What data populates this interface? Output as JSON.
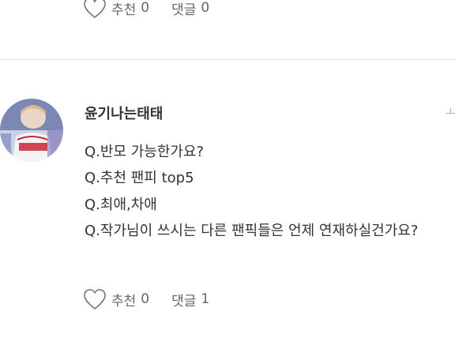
{
  "top_actions": {
    "recommend_label": "추천",
    "recommend_count": "0",
    "comment_label": "댓글",
    "comment_count": "0"
  },
  "comment": {
    "author": "윤기나는태태",
    "edge_glyph": "ㅗ",
    "lines": [
      "Q.반모 가능한가요?",
      "Q.추천 팬피 top5",
      "Q.최애,차애",
      "Q.작가님이 쓰시는 다른 팬픽들은 언제 연재하실건가요?"
    ]
  },
  "bottom_actions": {
    "recommend_label": "추천",
    "recommend_count": "0",
    "comment_label": "댓글",
    "comment_count": "1"
  }
}
